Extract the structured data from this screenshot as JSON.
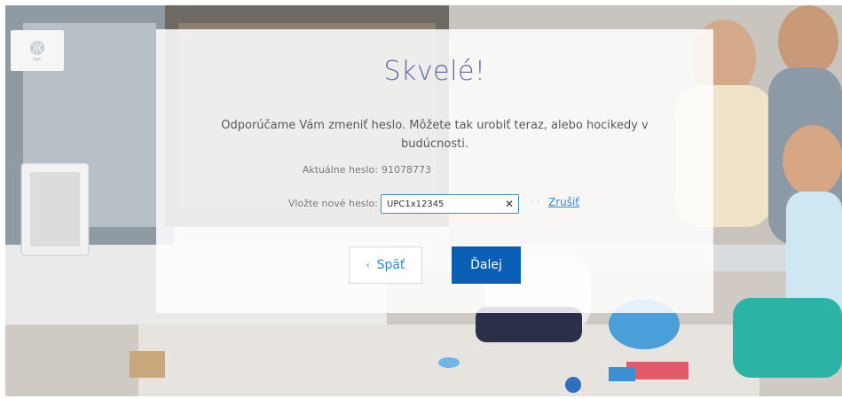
{
  "brand": {
    "logo_text": "upc"
  },
  "dialog": {
    "title": "Skvelé!",
    "description": "Odporúčame Vám zmeniť heslo. Môžete tak urobiť teraz, alebo hocikedy v budúcnosti.",
    "current_password_label": "Aktuálne heslo:",
    "current_password_value": "91078773",
    "new_password_label": "Vložte nové heslo:",
    "new_password_value": "UPC1x12345",
    "clear_icon": "close-icon",
    "cancel_link": "Zrušiť",
    "back_button": "Späť",
    "next_button": "Ďalej"
  },
  "colors": {
    "title": "#5b6aa3",
    "primary_button": "#0a5fb4",
    "link": "#2f86d8",
    "input_border": "#3b8fd6"
  }
}
